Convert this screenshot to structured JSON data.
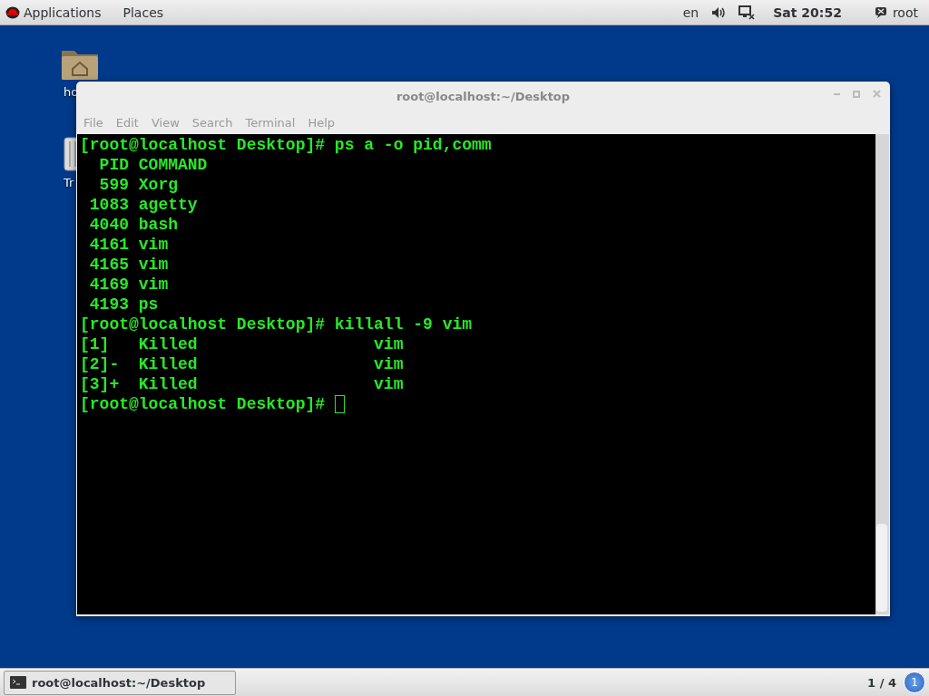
{
  "top_bar": {
    "menus": [
      "Applications",
      "Places"
    ],
    "language": "en",
    "clock": "Sat 20:52",
    "user": "root"
  },
  "desktop_icons": [
    {
      "kind": "home",
      "label": "ho"
    },
    {
      "kind": "trash",
      "label": "Tr"
    }
  ],
  "window": {
    "title": "root@localhost:~/Desktop",
    "menu": [
      "File",
      "Edit",
      "View",
      "Search",
      "Terminal",
      "Help"
    ],
    "terminal_lines": [
      "[root@localhost Desktop]# ps a -o pid,comm",
      "  PID COMMAND",
      "  599 Xorg",
      " 1083 agetty",
      " 4040 bash",
      " 4161 vim",
      " 4165 vim",
      " 4169 vim",
      " 4193 ps",
      "[root@localhost Desktop]# killall -9 vim",
      "[1]   Killed                  vim",
      "[2]-  Killed                  vim",
      "[3]+  Killed                  vim",
      "[root@localhost Desktop]# "
    ],
    "cursor_visible": true
  },
  "bottom_bar": {
    "task": "root@localhost:~/Desktop",
    "workspace": "1 / 4",
    "workspace_badge": "1"
  }
}
